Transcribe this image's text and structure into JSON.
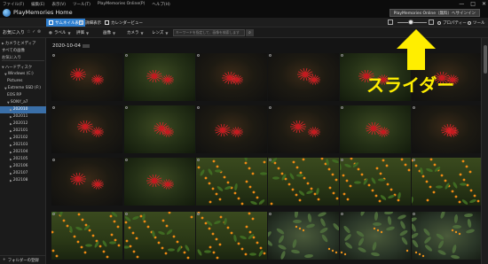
{
  "menu": {
    "items": [
      "ファイル(F)",
      "編集(E)",
      "表示(V)",
      "ツール(T)",
      "PlayMemories Online(P)",
      "ヘルプ(H)"
    ]
  },
  "window_controls": [
    "—",
    "□",
    "✕"
  ],
  "app": {
    "title": "PlayMemories Home",
    "pmo_button": "PlayMemories Online（無料）へサインイン"
  },
  "toolbar": {
    "view_thumbnail": "サムネイル表示",
    "view_detail": "詳細表示",
    "view_calendar": "カレンダービュー",
    "properties": "プロパティー",
    "tools": "ツール"
  },
  "filterbar": {
    "favorites": "お気に入り",
    "fav_icons": "☆ ✓ ⊗",
    "filters": [
      {
        "icon": "●",
        "label": "ラベル"
      },
      {
        "icon": "",
        "label": "評価"
      },
      {
        "icon": "",
        "label": "画像"
      },
      {
        "icon": "",
        "label": "カメラ"
      },
      {
        "icon": "",
        "label": "レンズ"
      }
    ],
    "search_placeholder": "キーワードを指定して、画像を検索します"
  },
  "sidebar": {
    "items": [
      {
        "label": "カメラとメディア",
        "indent": 0,
        "prefix": "▶",
        "selected": false
      },
      {
        "label": "すべての画像",
        "indent": 0,
        "prefix": "",
        "selected": false
      },
      {
        "label": "お気に入り",
        "indent": 0,
        "prefix": "",
        "selected": false
      },
      {
        "label": "ハードディスク",
        "indent": 0,
        "prefix": "▼",
        "selected": false
      },
      {
        "label": "Windows (C:)",
        "indent": 1,
        "prefix": "▼",
        "selected": false
      },
      {
        "label": "Pictures",
        "indent": 2,
        "prefix": "",
        "selected": false
      },
      {
        "label": "Extreme SSD (F:)",
        "indent": 1,
        "prefix": "▼",
        "selected": false
      },
      {
        "label": "EOS RP",
        "indent": 2,
        "prefix": "",
        "selected": false
      },
      {
        "label": "SONY_a7",
        "indent": 2,
        "prefix": "▼",
        "selected": false
      },
      {
        "label": "202010",
        "indent": 3,
        "prefix": "▶",
        "selected": true
      },
      {
        "label": "202011",
        "indent": 3,
        "prefix": "▶",
        "selected": false
      },
      {
        "label": "202012",
        "indent": 3,
        "prefix": "▶",
        "selected": false
      },
      {
        "label": "202101",
        "indent": 3,
        "prefix": "▶",
        "selected": false
      },
      {
        "label": "202102",
        "indent": 3,
        "prefix": "▶",
        "selected": false
      },
      {
        "label": "202103",
        "indent": 3,
        "prefix": "▶",
        "selected": false
      },
      {
        "label": "202104",
        "indent": 3,
        "prefix": "▶",
        "selected": false
      },
      {
        "label": "202105",
        "indent": 3,
        "prefix": "▶",
        "selected": false
      },
      {
        "label": "202106",
        "indent": 3,
        "prefix": "▶",
        "selected": false
      },
      {
        "label": "202107",
        "indent": 3,
        "prefix": "▶",
        "selected": false
      },
      {
        "label": "202108",
        "indent": 3,
        "prefix": "▶",
        "selected": false
      }
    ],
    "footer": "フォルダーの登録"
  },
  "content": {
    "date": "2020-10-04"
  },
  "colors": {
    "accent": "#2f7fcf",
    "selected_folder": "#3a6fa8",
    "annotation": "#ffee00"
  },
  "annotation": {
    "text": "スライダー"
  },
  "thumbnails": [
    "spider-lily-red",
    "spider-lily-red",
    "spider-lily-red",
    "spider-lily-red",
    "spider-lily-red",
    "spider-lily-red",
    "spider-lily-red",
    "spider-lily-red",
    "spider-lily-red",
    "spider-lily-red",
    "spider-lily-red",
    "spider-lily-red",
    "spider-lily-red",
    "spider-lily-red",
    "osmanthus-orange",
    "osmanthus-orange",
    "osmanthus-orange",
    "osmanthus-orange",
    "osmanthus-orange",
    "osmanthus-orange",
    "osmanthus-orange",
    "osmanthus-leaves",
    "osmanthus-leaves",
    "osmanthus-leaves"
  ]
}
